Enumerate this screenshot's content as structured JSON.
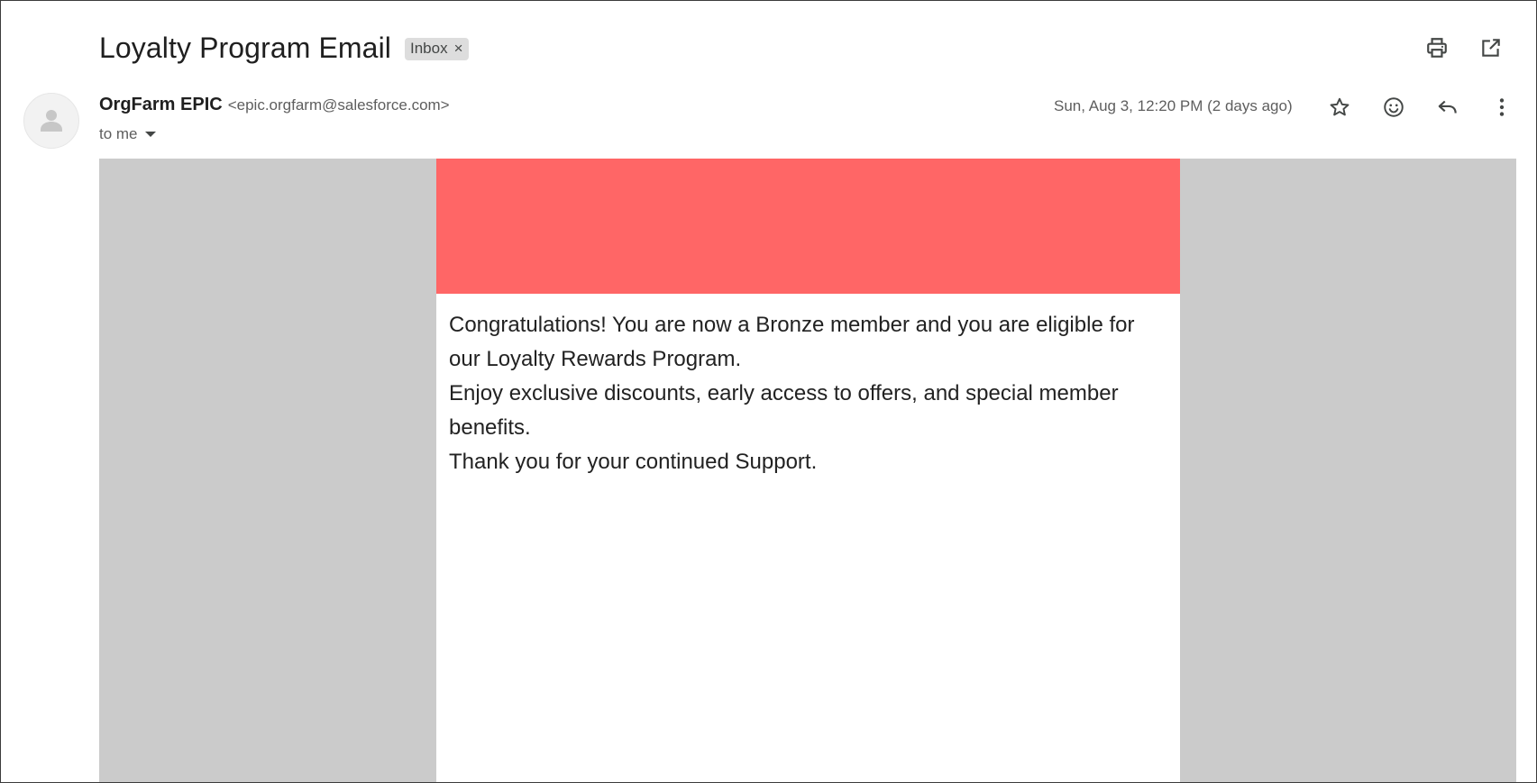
{
  "email": {
    "subject": "Loyalty Program Email",
    "label": "Inbox",
    "label_remove": "×",
    "sender_name": "OrgFarm EPIC",
    "sender_email": "<epic.orgfarm@salesforce.com>",
    "recipient": "to me",
    "date": "Sun, Aug 3, 12:20 PM (2 days ago)",
    "banner_color": "#ff6666",
    "body": {
      "line1": "Congratulations! You are now a Bronze member and you are eligible for our Loyalty Rewards Program.",
      "line2": "Enjoy exclusive discounts, early access to offers, and special member benefits.",
      "line3": "Thank you for your continued Support."
    }
  },
  "toolbar": {
    "icons": [
      "print-icon",
      "open-in-new-window-icon"
    ]
  },
  "message_actions": {
    "icons": [
      "star-icon",
      "emoji-reaction-icon",
      "reply-icon",
      "more-options-icon"
    ]
  },
  "colors": {
    "body_background": "#cbcbcb",
    "banner": "#ff6666"
  }
}
